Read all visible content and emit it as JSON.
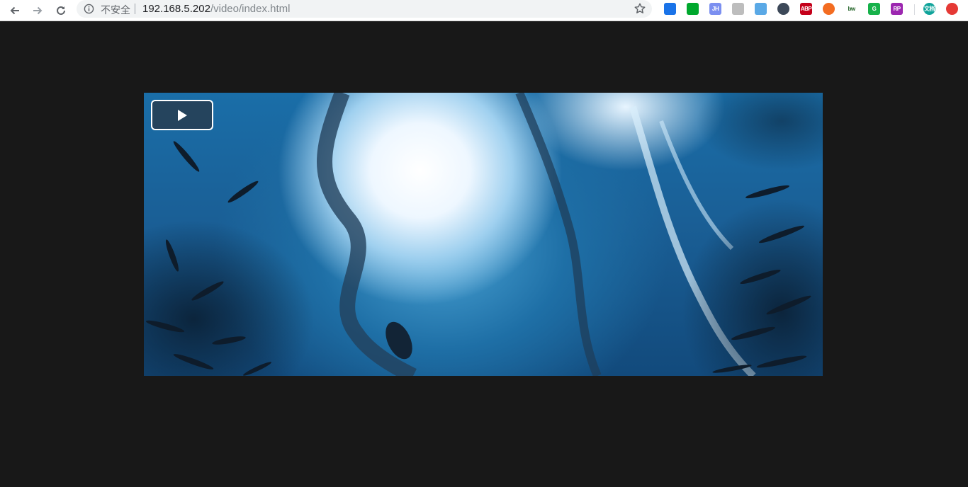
{
  "browser": {
    "security_label": "不安全",
    "url_host": "192.168.5.202",
    "url_path": "/video/index.html",
    "extensions": [
      {
        "label": "",
        "color": "#1a73e8"
      },
      {
        "label": "",
        "color": "#00a82d"
      },
      {
        "label": "JH",
        "color": "#7b8ff0"
      },
      {
        "label": "",
        "color": "#bdbdbd"
      },
      {
        "label": "",
        "color": "#5aa9e6"
      },
      {
        "label": "",
        "color": "#3c4858"
      },
      {
        "label": "ABP",
        "color": "#c4001a"
      },
      {
        "label": "",
        "color": "#f36c21"
      },
      {
        "label": "bw",
        "color": "#ffffff"
      },
      {
        "label": "G",
        "color": "#16b14a"
      },
      {
        "label": "RP",
        "color": "#9c27b0"
      },
      {
        "label": "文档",
        "color": "#0fa39a"
      },
      {
        "label": "",
        "color": "#e53935"
      }
    ]
  },
  "video": {
    "state": "paused"
  }
}
